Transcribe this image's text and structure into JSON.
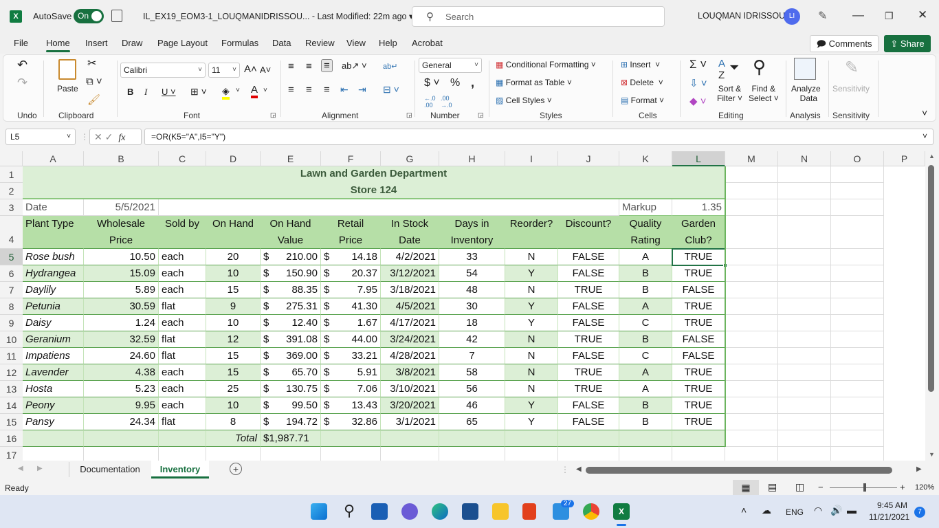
{
  "titlebar": {
    "autosave_label": "AutoSave",
    "autosave_state": "On",
    "doc_title": "IL_EX19_EOM3-1_LOUQMANIDRISSOU...  -  Last Modified: 22m ago  ▾",
    "search_placeholder": "Search",
    "user_name": "LOUQMAN IDRISSOU",
    "user_initials": "LI"
  },
  "menu": {
    "tabs": [
      "File",
      "Home",
      "Insert",
      "Draw",
      "Page Layout",
      "Formulas",
      "Data",
      "Review",
      "View",
      "Help",
      "Acrobat"
    ],
    "active": "Home",
    "comments_label": "Comments",
    "share_label": "Share"
  },
  "ribbon": {
    "groups": [
      "Undo",
      "Clipboard",
      "Font",
      "Alignment",
      "Number",
      "Styles",
      "Cells",
      "Editing",
      "Analysis",
      "Sensitivity"
    ],
    "paste_label": "Paste",
    "font_name": "Calibri",
    "font_size": "11",
    "number_format": "General",
    "conditional_formatting": "Conditional Formatting",
    "format_as_table": "Format as Table",
    "cell_styles": "Cell Styles",
    "insert": "Insert",
    "delete": "Delete",
    "format": "Format",
    "sort_filter_1": "Sort &",
    "sort_filter_2": "Filter",
    "find_select_1": "Find &",
    "find_select_2": "Select",
    "analyze_1": "Analyze",
    "analyze_2": "Data",
    "sensitivity": "Sensitivity"
  },
  "formula_bar": {
    "name_box": "L5",
    "formula": "=OR(K5=\"A\",I5=\"Y\")"
  },
  "columns": [
    "A",
    "B",
    "C",
    "D",
    "E",
    "F",
    "G",
    "H",
    "I",
    "J",
    "K",
    "L",
    "M",
    "N",
    "O",
    "P"
  ],
  "selected_column": "L",
  "selected_row": 5,
  "sheet": {
    "title1": "Lawn and Garden Department",
    "title2": "Store 124",
    "date_label": "Date",
    "date_value": "5/5/2021",
    "markup_label": "Markup",
    "markup_value": "1.35",
    "headers_top": [
      "",
      "Wholesale",
      "",
      "",
      "On Hand",
      "Retail",
      "In Stock",
      "Days in",
      "",
      "",
      "Quality",
      "Garden"
    ],
    "headers_bottom": [
      "Plant Type",
      "Price",
      "Sold by",
      "On Hand",
      "Value",
      "Price",
      "Date",
      "Inventory",
      "Reorder?",
      "Discount?",
      "Rating",
      "Club?"
    ],
    "rows": [
      [
        "Rose bush",
        "10.50",
        "each",
        "20",
        "210.00",
        "14.18",
        "4/2/2021",
        "33",
        "N",
        "FALSE",
        "A",
        "TRUE"
      ],
      [
        "Hydrangea",
        "15.09",
        "each",
        "10",
        "150.90",
        "20.37",
        "3/12/2021",
        "54",
        "Y",
        "FALSE",
        "B",
        "TRUE"
      ],
      [
        "Daylily",
        "5.89",
        "each",
        "15",
        "88.35",
        "7.95",
        "3/18/2021",
        "48",
        "N",
        "TRUE",
        "B",
        "FALSE"
      ],
      [
        "Petunia",
        "30.59",
        "flat",
        "9",
        "275.31",
        "41.30",
        "4/5/2021",
        "30",
        "Y",
        "FALSE",
        "A",
        "TRUE"
      ],
      [
        "Daisy",
        "1.24",
        "each",
        "10",
        "12.40",
        "1.67",
        "4/17/2021",
        "18",
        "Y",
        "FALSE",
        "C",
        "TRUE"
      ],
      [
        "Geranium",
        "32.59",
        "flat",
        "12",
        "391.08",
        "44.00",
        "3/24/2021",
        "42",
        "N",
        "TRUE",
        "B",
        "FALSE"
      ],
      [
        "Impatiens",
        "24.60",
        "flat",
        "15",
        "369.00",
        "33.21",
        "4/28/2021",
        "7",
        "N",
        "FALSE",
        "C",
        "FALSE"
      ],
      [
        "Lavender",
        "4.38",
        "each",
        "15",
        "65.70",
        "5.91",
        "3/8/2021",
        "58",
        "N",
        "TRUE",
        "A",
        "TRUE"
      ],
      [
        "Hosta",
        "5.23",
        "each",
        "25",
        "130.75",
        "7.06",
        "3/10/2021",
        "56",
        "N",
        "TRUE",
        "A",
        "TRUE"
      ],
      [
        "Peony",
        "9.95",
        "each",
        "10",
        "99.50",
        "13.43",
        "3/20/2021",
        "46",
        "Y",
        "FALSE",
        "B",
        "TRUE"
      ],
      [
        "Pansy",
        "24.34",
        "flat",
        "8",
        "194.72",
        "32.86",
        "3/1/2021",
        "65",
        "Y",
        "FALSE",
        "B",
        "TRUE"
      ]
    ],
    "currency_symbol": "$",
    "total_label": "Total",
    "total_value": "$1,987.71"
  },
  "sheet_tabs": [
    "Documentation",
    "Inventory"
  ],
  "active_sheet": "Inventory",
  "status": {
    "ready": "Ready",
    "zoom": "120%"
  },
  "taskbar": {
    "mail_badge": "27",
    "lang": "ENG",
    "time": "9:45 AM",
    "date": "11/21/2021",
    "notification_count": "7"
  },
  "colors": {
    "accent": "#17703f",
    "header_fill": "#b6dfa7",
    "band_fill": "#dcefd6"
  }
}
